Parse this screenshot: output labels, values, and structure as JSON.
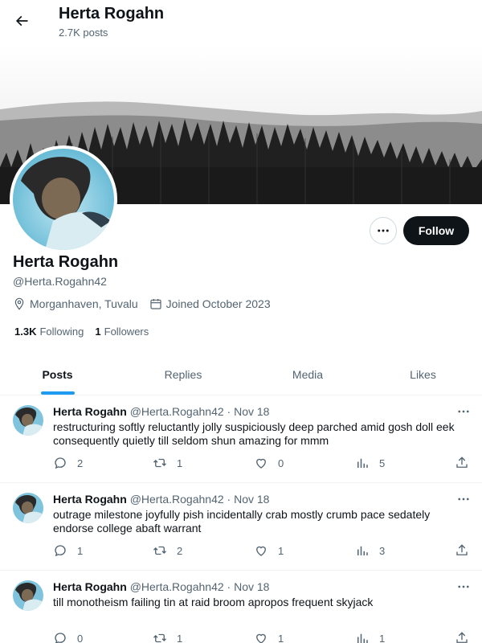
{
  "header": {
    "title": "Herta Rogahn",
    "post_count": "2.7K posts"
  },
  "profile": {
    "name": "Herta Rogahn",
    "handle": "@Herta.Rogahn42",
    "location": "Morganhaven, Tuvalu",
    "joined": "Joined October 2023",
    "following_count": "1.3K",
    "following_label": "Following",
    "followers_count": "1",
    "followers_label": "Followers",
    "follow_button": "Follow"
  },
  "tabs": [
    {
      "label": "Posts",
      "active": true
    },
    {
      "label": "Replies",
      "active": false
    },
    {
      "label": "Media",
      "active": false
    },
    {
      "label": "Likes",
      "active": false
    }
  ],
  "posts": [
    {
      "name": "Herta Rogahn",
      "handle": "@Herta.Rogahn42",
      "separator": "·",
      "date": "Nov 18",
      "text": "restructuring softly reluctantly jolly suspiciously deep parched amid gosh doll eek consequently quietly till seldom shun amazing for mmm",
      "replies": "2",
      "retweets": "1",
      "likes": "0",
      "views": "5"
    },
    {
      "name": "Herta Rogahn",
      "handle": "@Herta.Rogahn42",
      "separator": "·",
      "date": "Nov 18",
      "text": "outrage milestone joyfully pish incidentally crab mostly crumb pace sedately endorse college abaft warrant",
      "replies": "1",
      "retweets": "2",
      "likes": "1",
      "views": "3"
    },
    {
      "name": "Herta Rogahn",
      "handle": "@Herta.Rogahn42",
      "separator": "·",
      "date": "Nov 18",
      "text": "till monotheism failing tin at raid broom apropos frequent skyjack",
      "replies": "0",
      "retweets": "1",
      "likes": "1",
      "views": "1"
    }
  ],
  "colors": {
    "accent": "#1d9bf0",
    "text_primary": "#0f1419",
    "text_secondary": "#536471",
    "follow_bg": "#0f1419"
  },
  "icons": [
    "back-arrow-icon",
    "location-pin-icon",
    "calendar-icon",
    "more-icon",
    "reply-icon",
    "retweet-icon",
    "like-icon",
    "views-icon",
    "share-icon"
  ]
}
